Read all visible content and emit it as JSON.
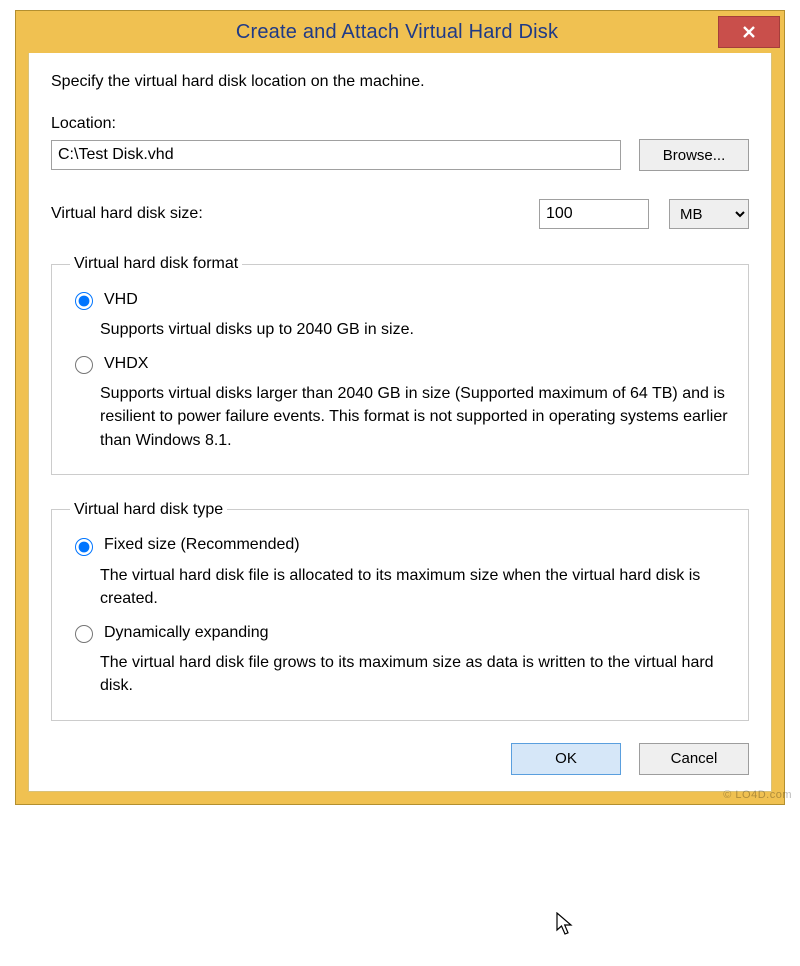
{
  "title": "Create and Attach Virtual Hard Disk",
  "instruction": "Specify the virtual hard disk location on the machine.",
  "location": {
    "label": "Location:",
    "value": "C:\\Test Disk.vhd",
    "browse": "Browse..."
  },
  "size": {
    "label": "Virtual hard disk size:",
    "value": "100",
    "unit": "MB"
  },
  "format_group": {
    "legend": "Virtual hard disk format",
    "options": [
      {
        "label": "VHD",
        "desc": "Supports virtual disks up to 2040 GB in size.",
        "checked": true
      },
      {
        "label": "VHDX",
        "desc": "Supports virtual disks larger than 2040 GB in size (Supported maximum of 64 TB) and is resilient to power failure events. This format is not supported in operating systems earlier than Windows 8.1.",
        "checked": false
      }
    ]
  },
  "type_group": {
    "legend": "Virtual hard disk type",
    "options": [
      {
        "label": "Fixed size (Recommended)",
        "desc": "The virtual hard disk file is allocated to its maximum size when the virtual hard disk is created.",
        "checked": true
      },
      {
        "label": "Dynamically expanding",
        "desc": "The virtual hard disk file grows to its maximum size as data is written to the virtual hard disk.",
        "checked": false
      }
    ]
  },
  "buttons": {
    "ok": "OK",
    "cancel": "Cancel"
  },
  "watermark": "© LO4D.com"
}
